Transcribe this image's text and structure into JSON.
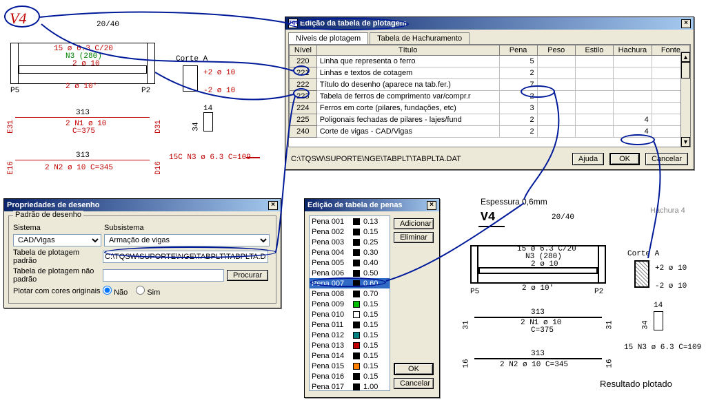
{
  "annotation_big_label": "V4",
  "cad_original": {
    "dim_top": "20/40",
    "n_rebar_top": "15 ø 6.3 C/20",
    "n_rebar_mid": "N3 (280)",
    "n_rebar_mid2": "2 ø 10",
    "n_rebar_bot": "2 ø 10'",
    "p_left": "P5",
    "p_right": "P2",
    "corte_label": "Corte A",
    "corte_plus": "+2 ø 10",
    "corte_minus": "-2 ø 10",
    "span1_len": "313",
    "span1_rebar": "2 N1 ø 10",
    "span1_c": "C=375",
    "span2_len": "313",
    "span2_rebar": "2 N2 ø 10 C=345",
    "e31_l": "E31",
    "d31_r": "D31",
    "e16_l": "E16",
    "d16_r": "D16",
    "tag14": "14",
    "tag34": "34",
    "extra_tag": "15C N3 ø 6.3 C=109"
  },
  "win_plot": {
    "title": "Edição da tabela de plotagem",
    "tab1": "Níveis de plotagem",
    "tab2": "Tabela de Hachuramento",
    "cols": {
      "nivel": "Nível",
      "titulo": "Título",
      "pena": "Pena",
      "peso": "Peso",
      "estilo": "Estilo",
      "hachura": "Hachura",
      "fonte": "Fonte"
    },
    "rows": [
      {
        "n": "220",
        "t": "Linha que representa o ferro",
        "pena": "5",
        "hach": "",
        "fonte": ""
      },
      {
        "n": "221",
        "t": "Linhas e textos de cotagem",
        "pena": "2",
        "hach": "",
        "fonte": ""
      },
      {
        "n": "222",
        "t": "Título do desenho (aparece na tab.fer.)",
        "pena": "7",
        "hach": "",
        "fonte": ""
      },
      {
        "n": "223",
        "t": "Tabela de ferros de comprimento var/compr.r",
        "pena": "2",
        "hach": "",
        "fonte": ""
      },
      {
        "n": "224",
        "t": "Ferros em corte (pilares, fundações, etc)",
        "pena": "3",
        "hach": "",
        "fonte": ""
      },
      {
        "n": "225",
        "t": "Poligonais fechadas de pilares - lajes/fund",
        "pena": "2",
        "hach": "4",
        "fonte": ""
      },
      {
        "n": "240",
        "t": "Corte de vigas - CAD/Vigas",
        "pena": "2",
        "hach": "4",
        "fonte": ""
      }
    ],
    "path": "C:\\TQSW\\SUPORTE\\NGE\\TABPLT\\TABPLTA.DAT",
    "btn_help": "Ajuda",
    "btn_ok": "OK",
    "btn_cancel": "Cancelar"
  },
  "win_prop": {
    "title": "Propriedades de desenho",
    "group": "Padrão de desenho",
    "lbl_sistema": "Sistema",
    "lbl_subsistema": "Subsistema",
    "val_sistema": "CAD/Vigas",
    "val_subsistema": "Armação de vigas",
    "lbl_tab_padrao": "Tabela de plotagem padrão",
    "val_tab_padrao": "C:\\TQSW\\SUPORTE\\NGE\\TABPLT\\TABPLTA.DAT",
    "lbl_tab_nao_padrao": "Tabela de plotagem não padrão",
    "val_tab_nao_padrao": "",
    "btn_procurar": "Procurar",
    "lbl_cores": "Plotar com cores originais",
    "radio_nao": "Não",
    "radio_sim": "Sim"
  },
  "win_pen": {
    "title": "Edição de tabela de penas",
    "pens": [
      {
        "name": "Pena 001",
        "color": "#000000",
        "w": "0.13"
      },
      {
        "name": "Pena 002",
        "color": "#000000",
        "w": "0.15"
      },
      {
        "name": "Pena 003",
        "color": "#000000",
        "w": "0.25"
      },
      {
        "name": "Pena 004",
        "color": "#000000",
        "w": "0.30"
      },
      {
        "name": "Pena 005",
        "color": "#000000",
        "w": "0.40"
      },
      {
        "name": "Pena 006",
        "color": "#000000",
        "w": "0.50"
      },
      {
        "name": "Pena 007",
        "color": "#000000",
        "w": "0.60"
      },
      {
        "name": "Pena 008",
        "color": "#000000",
        "w": "0.70"
      },
      {
        "name": "Pena 009",
        "color": "#00c000",
        "w": "0.15"
      },
      {
        "name": "Pena 010",
        "color": "#ffffff",
        "w": "0.15"
      },
      {
        "name": "Pena 011",
        "color": "#000000",
        "w": "0.15"
      },
      {
        "name": "Pena 012",
        "color": "#008080",
        "w": "0.15"
      },
      {
        "name": "Pena 013",
        "color": "#c00000",
        "w": "0.15"
      },
      {
        "name": "Pena 014",
        "color": "#000000",
        "w": "0.15"
      },
      {
        "name": "Pena 015",
        "color": "#ff8000",
        "w": "0.15"
      },
      {
        "name": "Pena 016",
        "color": "#000000",
        "w": "0.15"
      },
      {
        "name": "Pena 017",
        "color": "#000000",
        "w": "1.00"
      }
    ],
    "btn_add": "Adicionar",
    "btn_del": "Eliminar",
    "btn_ok": "OK",
    "btn_cancel": "Cancelar"
  },
  "result": {
    "espessura": "Espessura 0,6mm",
    "hachura": "Hachura 4",
    "v4": "V4",
    "dim": "20/40",
    "corte": "Corte A",
    "plus": "+2 ø 10",
    "minus": "-2 ø 10",
    "rebar_top": "15 ø 6.3 C/20",
    "rebar_mid": "N3 (280)",
    "rebar_mid2": "2 ø 10",
    "rebar_bot": "2 ø 10'",
    "p_left": "P5",
    "p_right": "P2",
    "span1_len": "313",
    "span1_rebar": "2 N1 ø 10",
    "span1_c": "C=375",
    "span2_len": "313",
    "span2_rebar": "2 N2 ø 10 C=345",
    "l31": "31",
    "r31": "31",
    "l16": "16",
    "r16": "16",
    "tag14": "14",
    "tag34": "34",
    "extra_tag": "15 N3 ø 6.3 C=109",
    "caption": "Resultado plotado"
  }
}
